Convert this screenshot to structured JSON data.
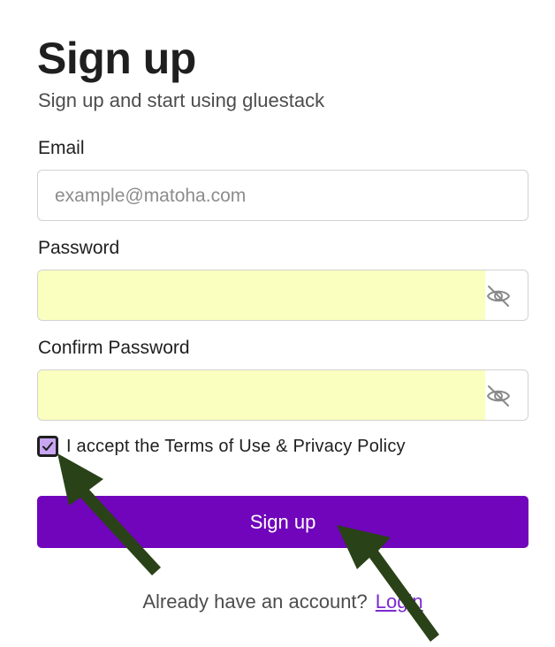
{
  "header": {
    "title": "Sign up",
    "subtitle": "Sign up and start using gluestack"
  },
  "form": {
    "email": {
      "label": "Email",
      "placeholder": "example@matoha.com",
      "value": ""
    },
    "password": {
      "label": "Password",
      "value": "",
      "autofill_color": "#fafebe",
      "toggle_icon": "eye-off-icon"
    },
    "confirm_password": {
      "label": "Confirm Password",
      "value": "",
      "autofill_color": "#fafebe",
      "toggle_icon": "eye-off-icon"
    },
    "terms": {
      "checked": true,
      "label": "I accept the Terms of Use & Privacy Policy"
    },
    "submit_label": "Sign up"
  },
  "footer": {
    "prompt": "Already have an account?",
    "login_label": "Login"
  },
  "colors": {
    "primary": "#7005bb",
    "checkbox_fill": "#c8a6f2",
    "link": "#7c2ad0",
    "annotation_arrow": "#2a4218"
  }
}
